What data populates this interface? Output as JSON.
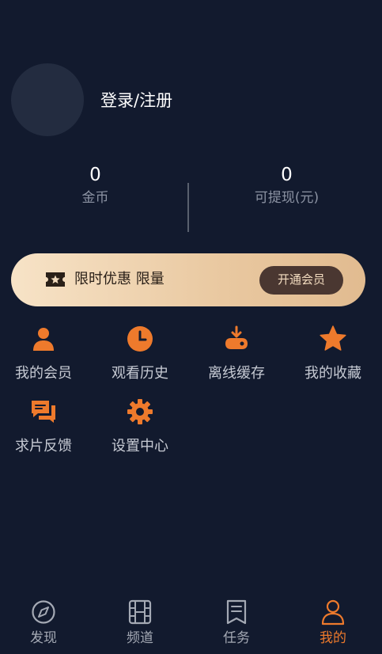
{
  "profile": {
    "login_label": "登录/注册"
  },
  "stats": [
    {
      "value": "0",
      "label": "金币"
    },
    {
      "value": "0",
      "label": "可提现(元)"
    }
  ],
  "vip_banner": {
    "text": "限时优惠 限量",
    "button_label": "开通会员"
  },
  "menu": [
    {
      "label": "我的会员",
      "icon": "person-icon"
    },
    {
      "label": "观看历史",
      "icon": "clock-icon"
    },
    {
      "label": "离线缓存",
      "icon": "download-icon"
    },
    {
      "label": "我的收藏",
      "icon": "star-icon"
    },
    {
      "label": "求片反馈",
      "icon": "chat-icon"
    },
    {
      "label": "设置中心",
      "icon": "gear-icon"
    }
  ],
  "tabs": [
    {
      "label": "发现",
      "icon": "compass-icon",
      "active": false
    },
    {
      "label": "频道",
      "icon": "film-icon",
      "active": false
    },
    {
      "label": "任务",
      "icon": "task-icon",
      "active": false
    },
    {
      "label": "我的",
      "icon": "person-outline-icon",
      "active": true
    }
  ],
  "colors": {
    "background": "#121a2e",
    "accent": "#ee7a2c",
    "muted_text": "#8c93a3"
  }
}
